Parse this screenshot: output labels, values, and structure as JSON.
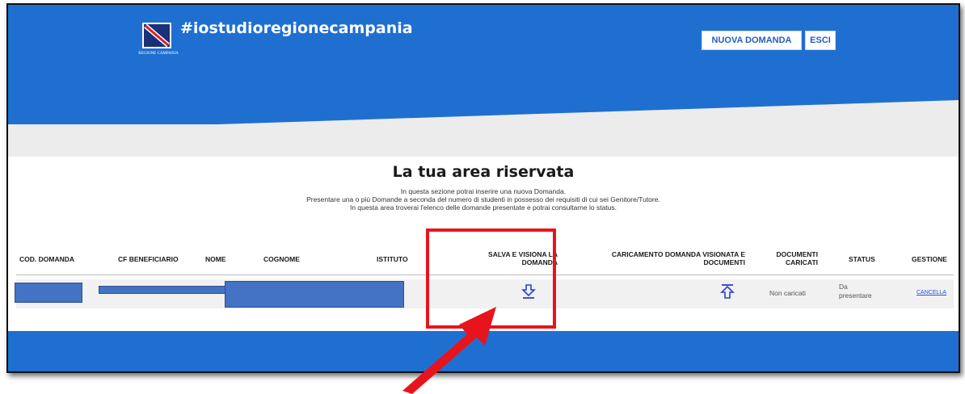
{
  "header": {
    "brand": "#iostudioregionecampania",
    "logo_caption": "REGIONE CAMPANIA",
    "buttons": {
      "new_application": "NUOVA DOMANDA",
      "exit": "ESCI"
    }
  },
  "main": {
    "title": "La tua area riservata",
    "intro": [
      "In questa sezione potrai inserire una nuova Domanda.",
      "Presentare una o più Domande a seconda del numero di studenti in possesso dei requisiti di cui sei Genitore/Tutore.",
      "In questa area troverai l'elenco delle domande presentate e potrai consultarne lo status."
    ]
  },
  "table": {
    "headers": {
      "cod_domanda": "COD. DOMANDA",
      "cf_beneficiario": "CF BENEFICIARIO",
      "nome": "NOME",
      "cognome": "COGNOME",
      "istituto": "ISTITUTO",
      "salva_1": "SALVA E VISIONA LA",
      "salva_2": "DOMANDA",
      "caricamento_1": "CARICAMENTO DOMANDA VISIONATA E",
      "caricamento_2": "DOCUMENTI",
      "documenti_1": "DOCUMENTI",
      "documenti_2": "CARICATI",
      "status": "STATUS",
      "gestione": "GESTIONE"
    },
    "row": {
      "documenti": "Non caricati",
      "status_1": "Da",
      "status_2": "presentare",
      "gestione": "CANCELLA"
    }
  },
  "colors": {
    "primary_blue": "#1f6fd1",
    "highlight_red": "#e8141c",
    "redaction_blue": "#4472c4"
  },
  "icons": [
    "download-icon",
    "upload-icon"
  ]
}
